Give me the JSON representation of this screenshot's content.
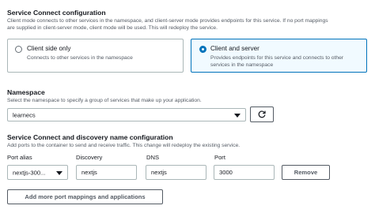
{
  "service_connect": {
    "title": "Service Connect configuration",
    "description_line1": "Client mode connects to other services in the namespace, and client-server mode provides endpoints for this service. If no port mappings",
    "description_line2": "are supplied in client-server mode, client mode will be used. This will redeploy the service.",
    "options": [
      {
        "label": "Client side only",
        "description": "Connects to other services in the namespace",
        "selected": false
      },
      {
        "label": "Client and server",
        "description_line1": "Provides endpoints for this service and connects to other",
        "description_line2": "services in the namespace",
        "selected": true
      }
    ]
  },
  "namespace": {
    "label": "Namespace",
    "description": "Select the namespace to specify a group of services that make up your application.",
    "value": "learnecs",
    "refresh_icon": "refresh-icon"
  },
  "discovery": {
    "title": "Service Connect and discovery name configuration",
    "description": "Add ports to the container to send and receive traffic. This change will redeploy the existing service.",
    "columns": {
      "port_alias": "Port alias",
      "discovery": "Discovery",
      "dns": "DNS",
      "port": "Port"
    },
    "row": {
      "port_alias": "nextjs-300...",
      "discovery": "nextjs",
      "dns": "nextjs",
      "port": "3000"
    },
    "remove_label": "Remove",
    "add_more_label": "Add more port mappings and applications"
  },
  "colors": {
    "accent": "#0073bb",
    "text": "#16191f",
    "muted": "#545b64",
    "border": "#aab7b8"
  }
}
